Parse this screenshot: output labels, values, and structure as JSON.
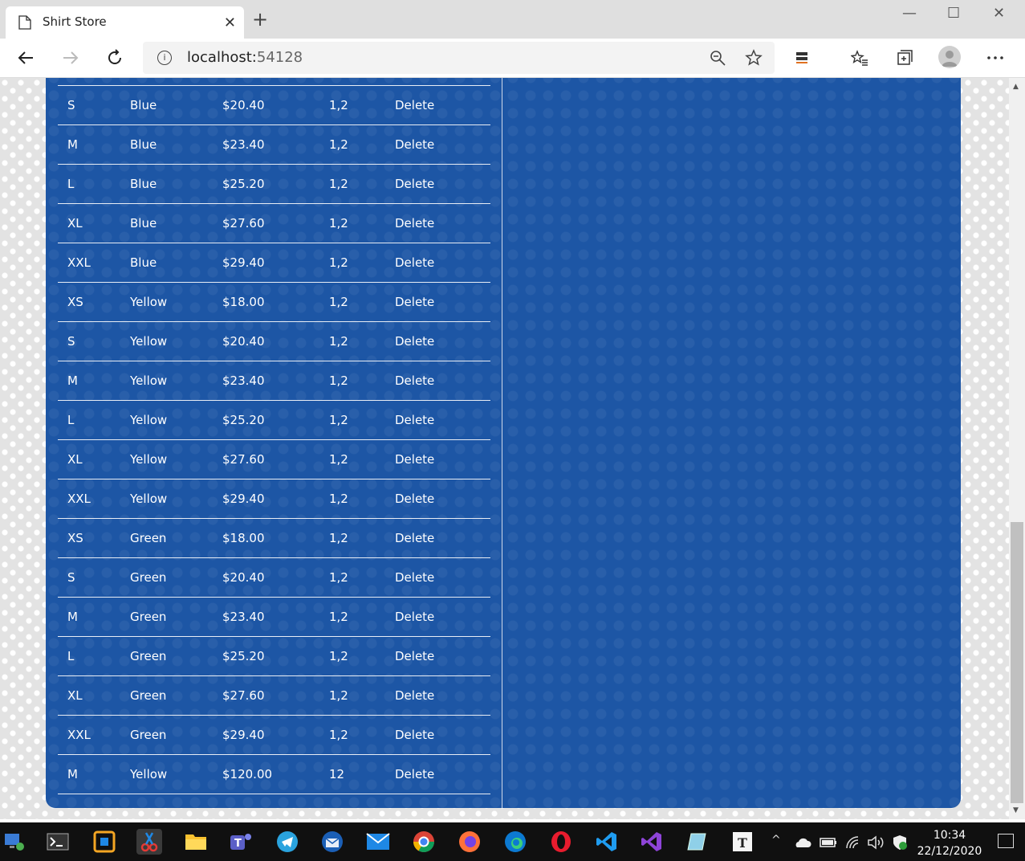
{
  "browser": {
    "tab_title": "Shirt Store",
    "tab_close": "✕",
    "new_tab": "+",
    "address_host": "localhost:",
    "address_port": "54128",
    "window_controls": {
      "minimize": "—",
      "maximize": "☐",
      "close": "✕"
    }
  },
  "table": {
    "rows": [
      {
        "size": "S",
        "color": "Blue",
        "price": "$20.40",
        "qty": "1,2",
        "action": "Delete"
      },
      {
        "size": "M",
        "color": "Blue",
        "price": "$23.40",
        "qty": "1,2",
        "action": "Delete"
      },
      {
        "size": "L",
        "color": "Blue",
        "price": "$25.20",
        "qty": "1,2",
        "action": "Delete"
      },
      {
        "size": "XL",
        "color": "Blue",
        "price": "$27.60",
        "qty": "1,2",
        "action": "Delete"
      },
      {
        "size": "XXL",
        "color": "Blue",
        "price": "$29.40",
        "qty": "1,2",
        "action": "Delete"
      },
      {
        "size": "XS",
        "color": "Yellow",
        "price": "$18.00",
        "qty": "1,2",
        "action": "Delete"
      },
      {
        "size": "S",
        "color": "Yellow",
        "price": "$20.40",
        "qty": "1,2",
        "action": "Delete"
      },
      {
        "size": "M",
        "color": "Yellow",
        "price": "$23.40",
        "qty": "1,2",
        "action": "Delete"
      },
      {
        "size": "L",
        "color": "Yellow",
        "price": "$25.20",
        "qty": "1,2",
        "action": "Delete"
      },
      {
        "size": "XL",
        "color": "Yellow",
        "price": "$27.60",
        "qty": "1,2",
        "action": "Delete"
      },
      {
        "size": "XXL",
        "color": "Yellow",
        "price": "$29.40",
        "qty": "1,2",
        "action": "Delete"
      },
      {
        "size": "XS",
        "color": "Green",
        "price": "$18.00",
        "qty": "1,2",
        "action": "Delete"
      },
      {
        "size": "S",
        "color": "Green",
        "price": "$20.40",
        "qty": "1,2",
        "action": "Delete"
      },
      {
        "size": "M",
        "color": "Green",
        "price": "$23.40",
        "qty": "1,2",
        "action": "Delete"
      },
      {
        "size": "L",
        "color": "Green",
        "price": "$25.20",
        "qty": "1,2",
        "action": "Delete"
      },
      {
        "size": "XL",
        "color": "Green",
        "price": "$27.60",
        "qty": "1,2",
        "action": "Delete"
      },
      {
        "size": "XXL",
        "color": "Green",
        "price": "$29.40",
        "qty": "1,2",
        "action": "Delete"
      },
      {
        "size": "M",
        "color": "Yellow",
        "price": "$120.00",
        "qty": "12",
        "action": "Delete"
      }
    ]
  },
  "taskbar": {
    "apps": [
      "start-icon",
      "terminal-icon",
      "teamviewer-icon",
      "snipping-tool-icon",
      "file-explorer-icon",
      "teams-icon",
      "telegram-icon",
      "thunderbird-icon",
      "mail-icon",
      "chrome-icon",
      "firefox-icon",
      "edge-icon",
      "opera-icon",
      "vscode-icon",
      "visual-studio-icon",
      "notepad-icon",
      "typora-icon"
    ],
    "time": "10:34",
    "date": "22/12/2020"
  },
  "colors": {
    "panel": "#1d56a5",
    "page_bg": "#e3e3e3",
    "taskbar": "#101010"
  }
}
